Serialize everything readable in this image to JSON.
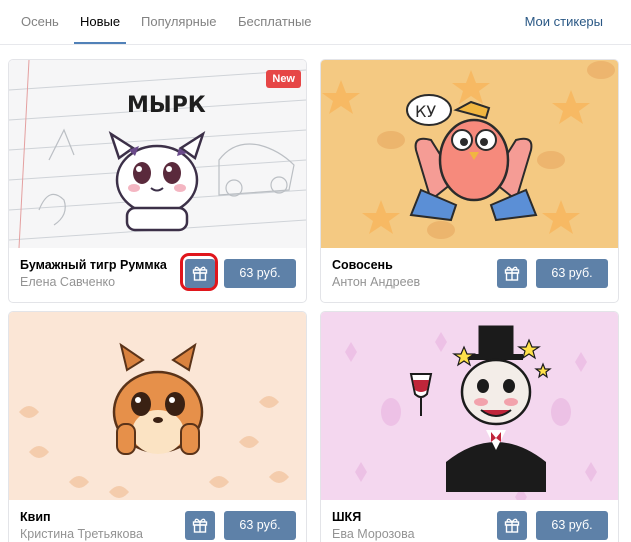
{
  "tabs": [
    {
      "label": "Осень",
      "active": false
    },
    {
      "label": "Новые",
      "active": true
    },
    {
      "label": "Популярные",
      "active": false
    },
    {
      "label": "Бесплатные",
      "active": false
    }
  ],
  "my_stickers_label": "Мои стикеры",
  "new_badge": "New",
  "cards": [
    {
      "title": "Бумажный тигр Руммка",
      "author": "Елена Савченко",
      "price": "63 руб.",
      "sticker_text": "МЫРК",
      "highlighted": true
    },
    {
      "title": "Совосень",
      "author": "Антон Андреев",
      "price": "63 руб.",
      "sticker_text": "КУ"
    },
    {
      "title": "Квип",
      "author": "Кристина Третьякова",
      "price": "63 руб."
    },
    {
      "title": "ШКЯ",
      "author": "Ева Морозова",
      "price": "63 руб."
    }
  ],
  "colors": {
    "accent": "#5181b8",
    "button": "#5e81a8",
    "link": "#2a5885",
    "badge": "#e64646",
    "highlight": "#e0161c"
  }
}
